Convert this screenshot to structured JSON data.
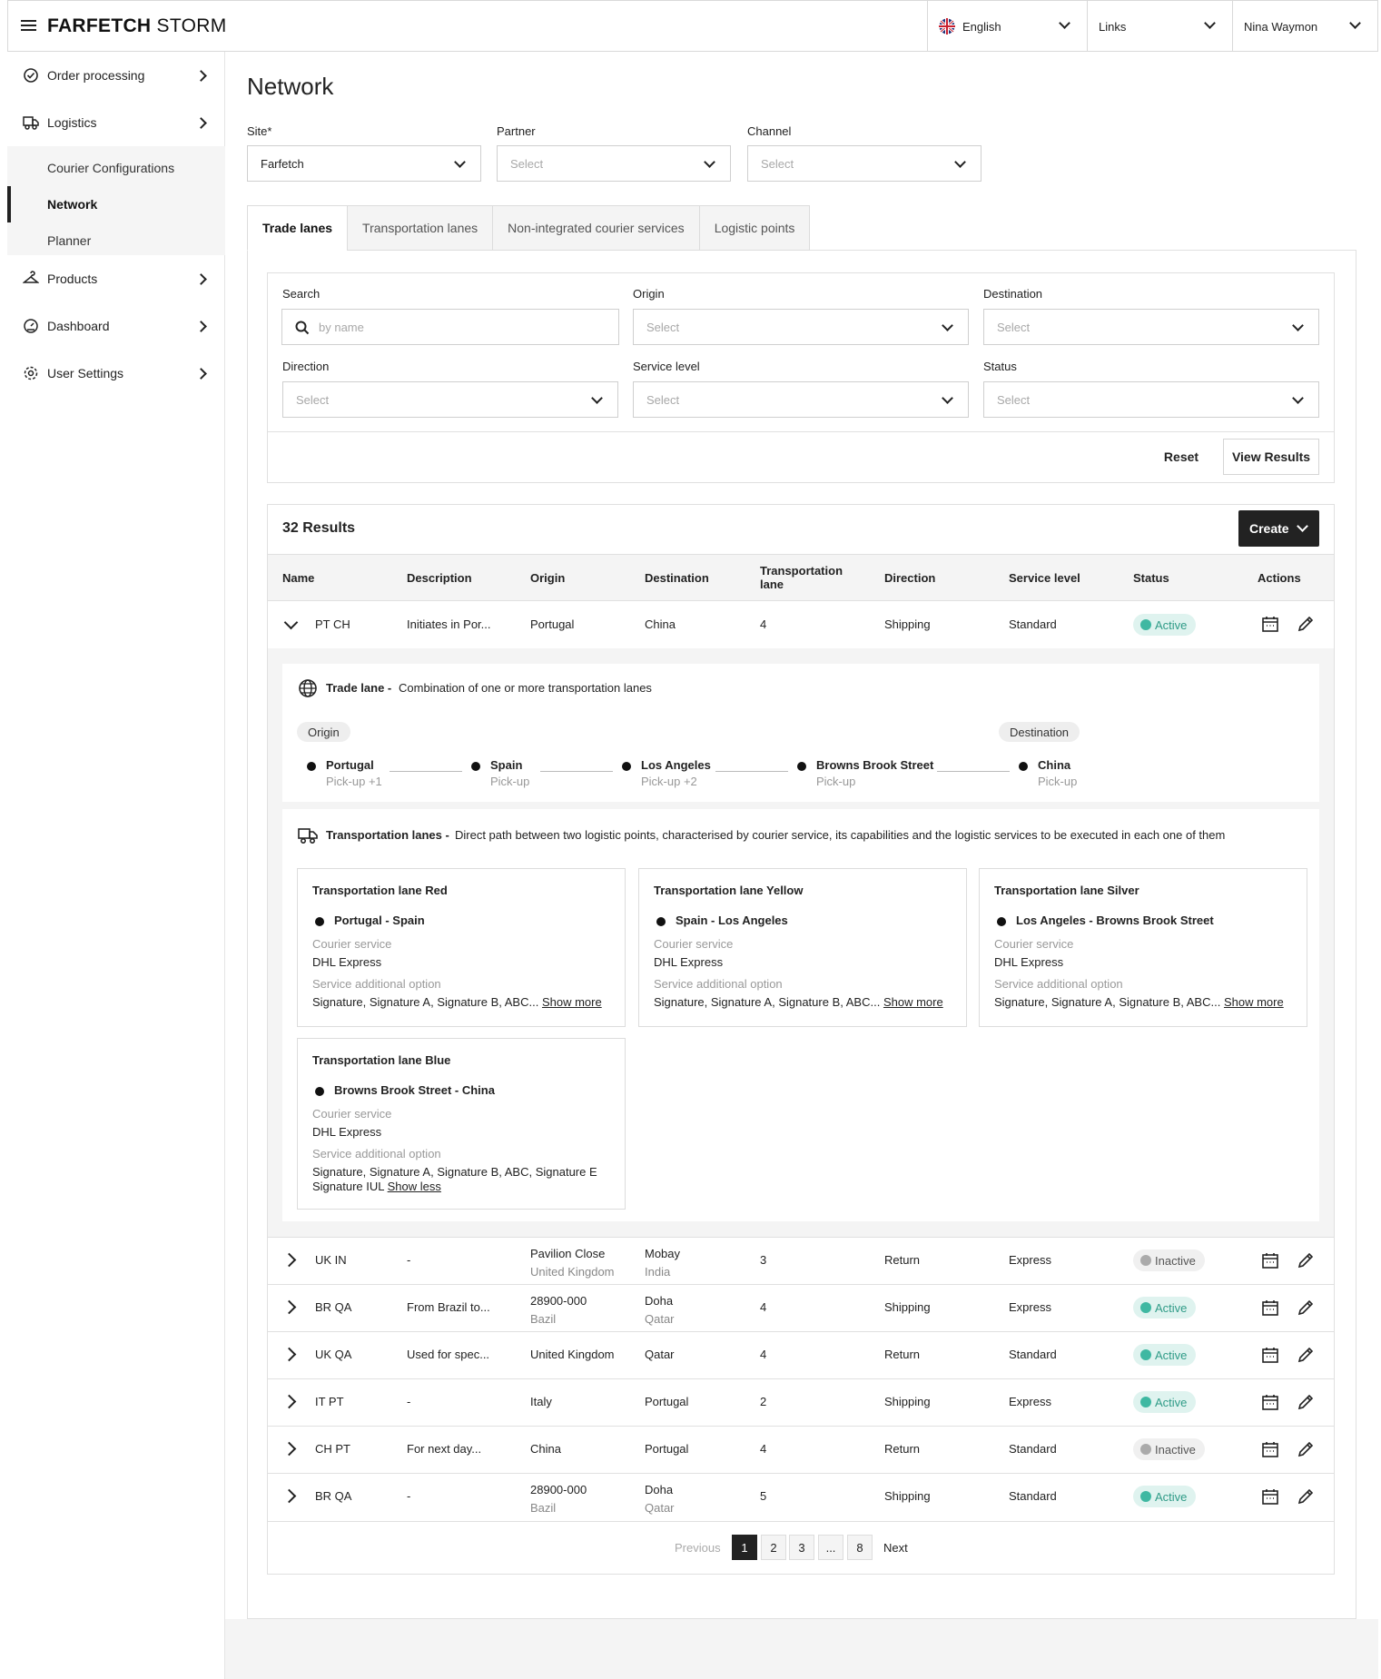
{
  "brand": {
    "bold": "FARFETCH",
    "light": " STORM"
  },
  "topbar": {
    "language": "English",
    "links": "Links",
    "user": "Nina Waymon"
  },
  "sidebar": {
    "order_processing": "Order processing",
    "logistics": "Logistics",
    "sub": [
      "Courier Configurations",
      "Network",
      "Planner"
    ],
    "products": "Products",
    "dashboard": "Dashboard",
    "user_settings": "User Settings"
  },
  "page": {
    "title": "Network"
  },
  "top_filters": {
    "site_label": "Site*",
    "site_value": "Farfetch",
    "partner_label": "Partner",
    "partner_value": "Select",
    "channel_label": "Channel",
    "channel_value": "Select"
  },
  "tabs": [
    "Trade lanes",
    "Transportation lanes",
    "Non-integrated courier services",
    "Logistic points"
  ],
  "filters": {
    "search_label": "Search",
    "search_placeholder": "by name",
    "origin_label": "Origin",
    "destination_label": "Destination",
    "direction_label": "Direction",
    "service_level_label": "Service level",
    "status_label": "Status",
    "select": "Select",
    "reset": "Reset",
    "view_results": "View Results"
  },
  "results": {
    "count": "32 Results",
    "create": "Create"
  },
  "columns": [
    "Name",
    "Description",
    "Origin",
    "Destination",
    "Transportation lane",
    "Direction",
    "Service level",
    "Status",
    "Actions"
  ],
  "expanded_row": {
    "name": "PT CH",
    "description": "Initiates in Por...",
    "origin": "Portugal",
    "destination": "China",
    "lane": "4",
    "direction": "Shipping",
    "service": "Standard",
    "status": "Active"
  },
  "trade_lane": {
    "title": "Trade lane -",
    "desc": "Combination of one or more transportation lanes",
    "origin_pill": "Origin",
    "destination_pill": "Destination",
    "stops": [
      {
        "name": "Portugal",
        "sub": "Pick-up +1"
      },
      {
        "name": "Spain",
        "sub": "Pick-up"
      },
      {
        "name": "Los Angeles",
        "sub": "Pick-up +2"
      },
      {
        "name": "Browns Brook Street",
        "sub": "Pick-up"
      },
      {
        "name": "China",
        "sub": "Pick-up"
      }
    ]
  },
  "transport_lanes": {
    "title": "Transportation lanes -",
    "desc": "Direct path between two logistic points, characterised by courier service, its capabilities and the logistic services to be executed in each one of them",
    "courier_label": "Courier service",
    "option_label": "Service additional option",
    "cards": [
      {
        "title": "Transportation lane Red",
        "route": "Portugal - Spain",
        "courier": "DHL Express",
        "options": "Signature, Signature A, Signature B, ABC...",
        "link": "Show more"
      },
      {
        "title": "Transportation lane Yellow",
        "route": "Spain - Los Angeles",
        "courier": "DHL Express",
        "options": "Signature, Signature A, Signature B, ABC...",
        "link": "Show more"
      },
      {
        "title": "Transportation lane Silver",
        "route": "Los Angeles - Browns Brook Street",
        "courier": "DHL Express",
        "options": "Signature, Signature A, Signature B, ABC...",
        "link": "Show more"
      },
      {
        "title": "Transportation lane Blue",
        "route": "Browns Brook Street - China",
        "courier": "DHL Express",
        "options": "Signature, Signature A, Signature B, ABC, Signature E Signature IUL",
        "link": "Show less"
      }
    ]
  },
  "rows": [
    {
      "name": "UK IN",
      "description": "-",
      "origin": "Pavilion Close",
      "origin_sub": "United Kingdom",
      "destination": "Mobay",
      "destination_sub": "India",
      "lane": "3",
      "direction": "Return",
      "service": "Express",
      "status": "Inactive"
    },
    {
      "name": "BR QA",
      "description": "From Brazil to...",
      "origin": "28900-000",
      "origin_sub": "Bazil",
      "destination": "Doha",
      "destination_sub": "Qatar",
      "lane": "4",
      "direction": "Shipping",
      "service": "Express",
      "status": "Active"
    },
    {
      "name": "UK QA",
      "description": "Used for spec...",
      "origin": "United Kingdom",
      "origin_sub": "",
      "destination": "Qatar",
      "destination_sub": "",
      "lane": "4",
      "direction": "Return",
      "service": "Standard",
      "status": "Active"
    },
    {
      "name": "IT PT",
      "description": "-",
      "origin": "Italy",
      "origin_sub": "",
      "destination": "Portugal",
      "destination_sub": "",
      "lane": "2",
      "direction": "Shipping",
      "service": "Express",
      "status": "Active"
    },
    {
      "name": "CH PT",
      "description": "For next day...",
      "origin": "China",
      "origin_sub": "",
      "destination": "Portugal",
      "destination_sub": "",
      "lane": "4",
      "direction": "Return",
      "service": "Standard",
      "status": "Inactive"
    },
    {
      "name": "BR QA",
      "description": "-",
      "origin": "28900-000",
      "origin_sub": "Bazil",
      "destination": "Doha",
      "destination_sub": "Qatar",
      "lane": "5",
      "direction": "Shipping",
      "service": "Standard",
      "status": "Active"
    }
  ],
  "pagination": {
    "previous": "Previous",
    "pages": [
      "1",
      "2",
      "3",
      "...",
      "8"
    ],
    "next": "Next"
  }
}
